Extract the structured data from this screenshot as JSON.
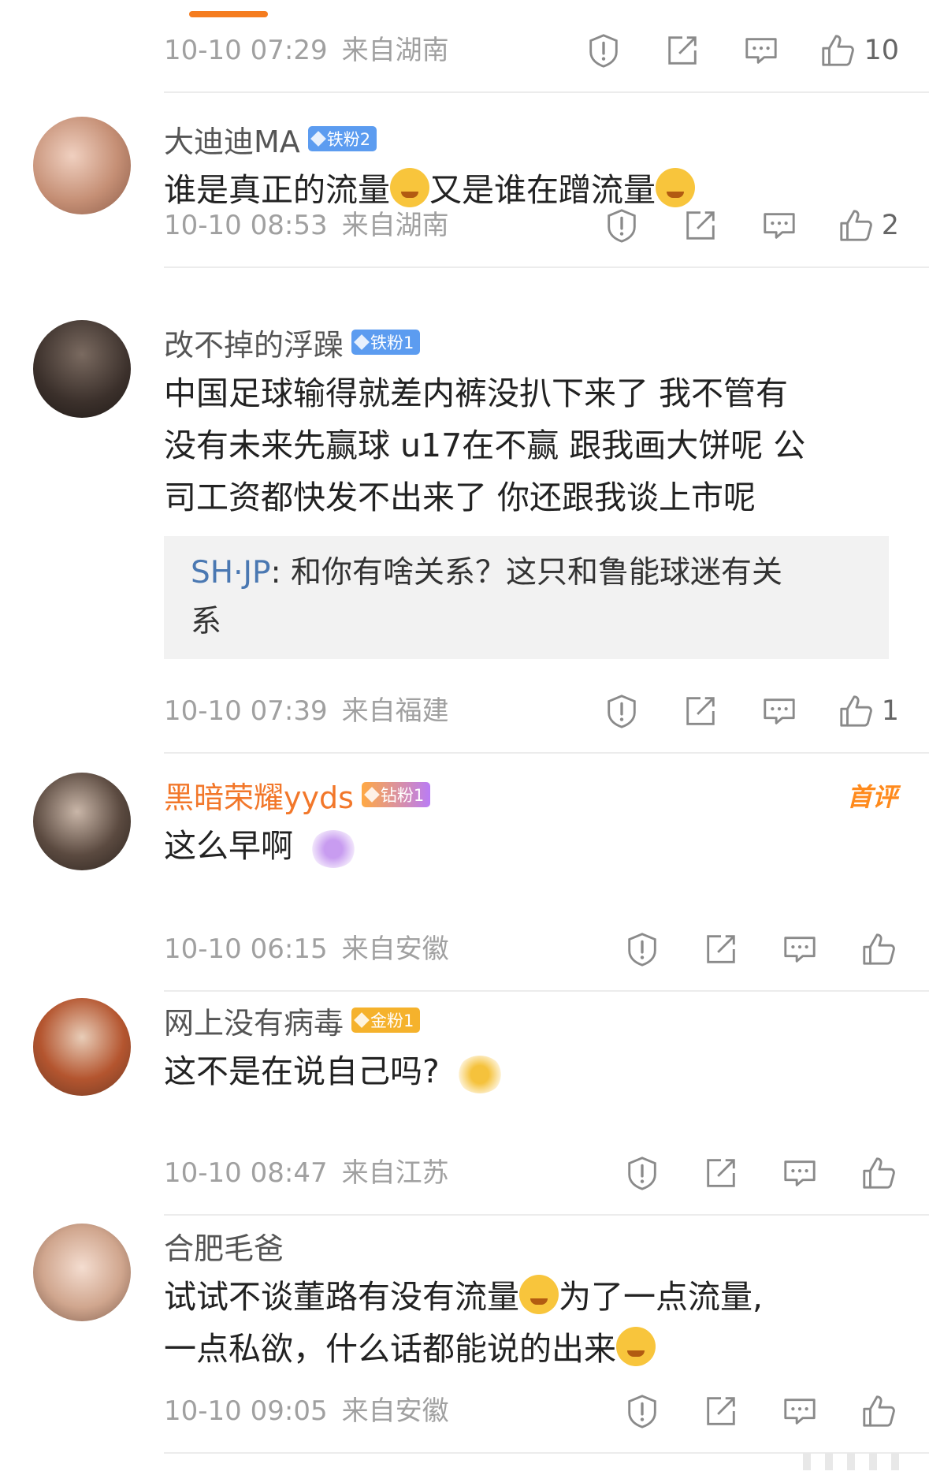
{
  "comments": [
    {
      "time": "10-10 07:29",
      "location": "来自湖南",
      "likes": "10"
    },
    {
      "name": "大迪迪MA",
      "badge": "铁粉2",
      "text_1": "谁是真正的流量",
      "text_2": "又是谁在蹭流量",
      "time": "10-10 08:53",
      "location": "来自湖南",
      "likes": "2"
    },
    {
      "name": "改不掉的浮躁",
      "badge": "铁粉1",
      "lines": [
        "中国足球输得就差内裤没扒下来了 我不管有",
        "没有未来先赢球 u17在不赢  跟我画大饼呢  公",
        "司工资都快发不出来了 你还跟我谈上市呢"
      ],
      "reply_name": "SH·JP",
      "reply_sep": ":",
      "reply_text_1": " 和你有啥关系？这只和鲁能球迷有关",
      "reply_text_2": "系",
      "time": "10-10 07:39",
      "location": "来自福建",
      "likes": "1"
    },
    {
      "name": "黑暗荣耀yyds",
      "badge": "钻粉1",
      "tag": "首评",
      "text": "这么早啊",
      "time": "10-10 06:15",
      "location": "来自安徽",
      "likes": ""
    },
    {
      "name": "网上没有病毒",
      "badge": "金粉1",
      "text": "这不是在说自己吗?",
      "time": "10-10 08:47",
      "location": "来自江苏",
      "likes": ""
    },
    {
      "name": "合肥毛爸",
      "text_1": "试试不谈董路有没有流量",
      "text_2": "为了一点流量,",
      "text_3": "一点私欲，什么话都能说的出来",
      "time": "10-10 09:05",
      "location": "来自安徽",
      "likes": ""
    }
  ],
  "icons": {
    "report": "warning-circle-icon",
    "share": "share-edit-icon",
    "comment": "comment-bubble-icon",
    "like": "thumb-up-icon"
  }
}
